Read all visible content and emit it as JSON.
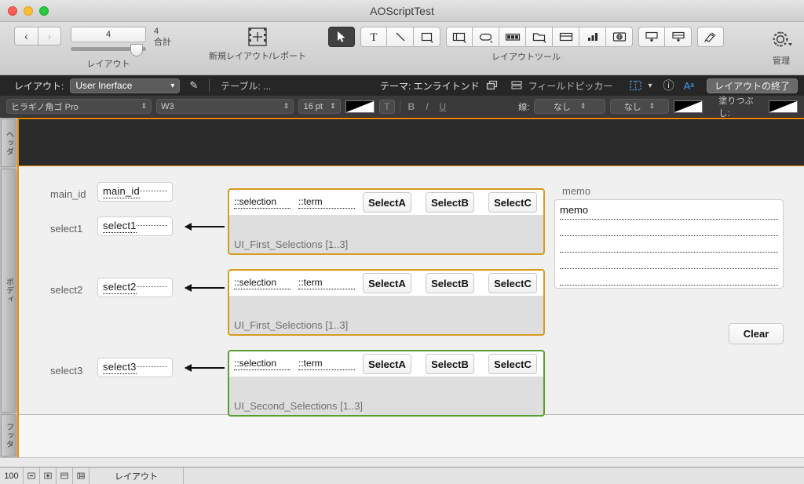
{
  "window": {
    "title": "AOScriptTest",
    "traffic_lights": [
      "close",
      "minimize",
      "zoom"
    ]
  },
  "toolbar": {
    "nav_back": "‹",
    "nav_forward": "›",
    "layout_index": "4",
    "layout_caption": "レイアウト",
    "total_count": "4",
    "total_label": "合計",
    "new_layout_caption": "新規レイアウト/レポート",
    "tools_caption": "レイアウトツール",
    "tools": [
      {
        "name": "pointer-tool",
        "selected": true
      },
      {
        "name": "text-tool",
        "selected": false
      },
      {
        "name": "line-tool",
        "selected": false
      },
      {
        "name": "rectangle-tool",
        "selected": false
      },
      {
        "name": "rounded-rect-tool",
        "selected": false
      },
      {
        "name": "oval-tool",
        "selected": false
      },
      {
        "name": "button-bar-tool",
        "selected": false
      },
      {
        "name": "tab-control-tool",
        "selected": false
      },
      {
        "name": "slide-control-tool",
        "selected": false
      },
      {
        "name": "chart-tool",
        "selected": false
      },
      {
        "name": "web-viewer-tool",
        "selected": false
      },
      {
        "name": "portal-tool",
        "selected": false
      },
      {
        "name": "field-tool",
        "selected": false
      },
      {
        "name": "format-painter-tool",
        "selected": false
      }
    ],
    "manage_label": "管理"
  },
  "layoutbar": {
    "layout_label": "レイアウト:",
    "layout_value": "User Inerface",
    "table_label": "テーブル: ...",
    "theme_label": "テーマ: エンライトンド",
    "field_picker": "フィールドピッカー",
    "exit_layout": "レイアウトの終了",
    "info_icon": "ⓘ",
    "text_icon": "Aᵃ"
  },
  "formatbar": {
    "font_family": "ヒラギノ角ゴ Pro",
    "font_weight": "W3",
    "font_size": "16 pt",
    "bold": "B",
    "italic": "I",
    "underline": "U",
    "line_label": "線:",
    "line_width": "なし",
    "line_style": "なし",
    "fill_label": "塗りつぶし:"
  },
  "parts": [
    {
      "name": "header-part",
      "label": "ヘッダ"
    },
    {
      "name": "body-part",
      "label": "ボディ"
    },
    {
      "name": "footer-part",
      "label": "フッタ"
    }
  ],
  "canvas": {
    "fields": [
      {
        "label": "main_id",
        "value": "main_id"
      },
      {
        "label": "select1",
        "value": "select1"
      },
      {
        "label": "select2",
        "value": "select2"
      },
      {
        "label": "select3",
        "value": "select3"
      }
    ],
    "portals": [
      {
        "name": "UI_First_Selections [1..3]",
        "border_color": "#d79b1e",
        "row_fields": [
          "::selection",
          "::term"
        ],
        "buttons": [
          "SelectA",
          "SelectB",
          "SelectC"
        ]
      },
      {
        "name": "UI_First_Selections [1..3]",
        "border_color": "#d79b1e",
        "row_fields": [
          "::selection",
          "::term"
        ],
        "buttons": [
          "SelectA",
          "SelectB",
          "SelectC"
        ]
      },
      {
        "name": "UI_Second_Selections [1..3]",
        "border_color": "#5a9e32",
        "row_fields": [
          "::selection",
          "::term"
        ],
        "buttons": [
          "SelectA",
          "SelectB",
          "SelectC"
        ]
      }
    ],
    "memo": {
      "label": "memo",
      "value": "memo",
      "line_count": 7,
      "clear_button": "Clear"
    }
  },
  "statusbar": {
    "zoom": "100",
    "zoom_out": "−",
    "zoom_in": "+",
    "mode_label": "レイアウト"
  },
  "colors": {
    "accent_orange": "#f08a00",
    "portal_gold": "#d79b1e",
    "portal_green": "#5a9e32",
    "header_band": "#2b2b2b"
  }
}
